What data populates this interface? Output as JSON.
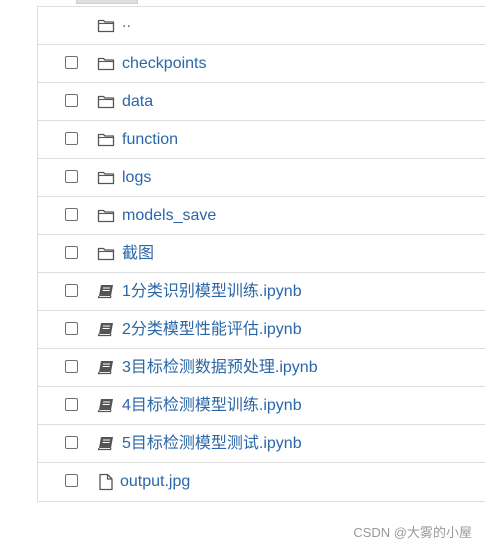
{
  "file_list": {
    "parent_dir": "..",
    "items": [
      {
        "name": "checkpoints",
        "kind": "folder",
        "icon": "folder-icon"
      },
      {
        "name": "data",
        "kind": "folder",
        "icon": "folder-icon"
      },
      {
        "name": "function",
        "kind": "folder",
        "icon": "folder-icon"
      },
      {
        "name": "logs",
        "kind": "folder",
        "icon": "folder-icon"
      },
      {
        "name": "models_save",
        "kind": "folder",
        "icon": "folder-icon"
      },
      {
        "name": "截图",
        "kind": "folder",
        "icon": "folder-icon"
      },
      {
        "name": "1分类识别模型训练.ipynb",
        "kind": "notebook",
        "icon": "notebook-icon"
      },
      {
        "name": "2分类模型性能评估.ipynb",
        "kind": "notebook",
        "icon": "notebook-icon"
      },
      {
        "name": "3目标检测数据预处理.ipynb",
        "kind": "notebook",
        "icon": "notebook-icon"
      },
      {
        "name": "4目标检测模型训练.ipynb",
        "kind": "notebook",
        "icon": "notebook-icon"
      },
      {
        "name": "5目标检测模型测试.ipynb",
        "kind": "notebook",
        "icon": "notebook-icon"
      },
      {
        "name": "output.jpg",
        "kind": "file",
        "icon": "file-icon"
      }
    ]
  },
  "watermark": "CSDN @大雾的小屋",
  "colors": {
    "link": "#2a66a8",
    "border": "#dddddd",
    "watermark": "#9a9a9a"
  }
}
